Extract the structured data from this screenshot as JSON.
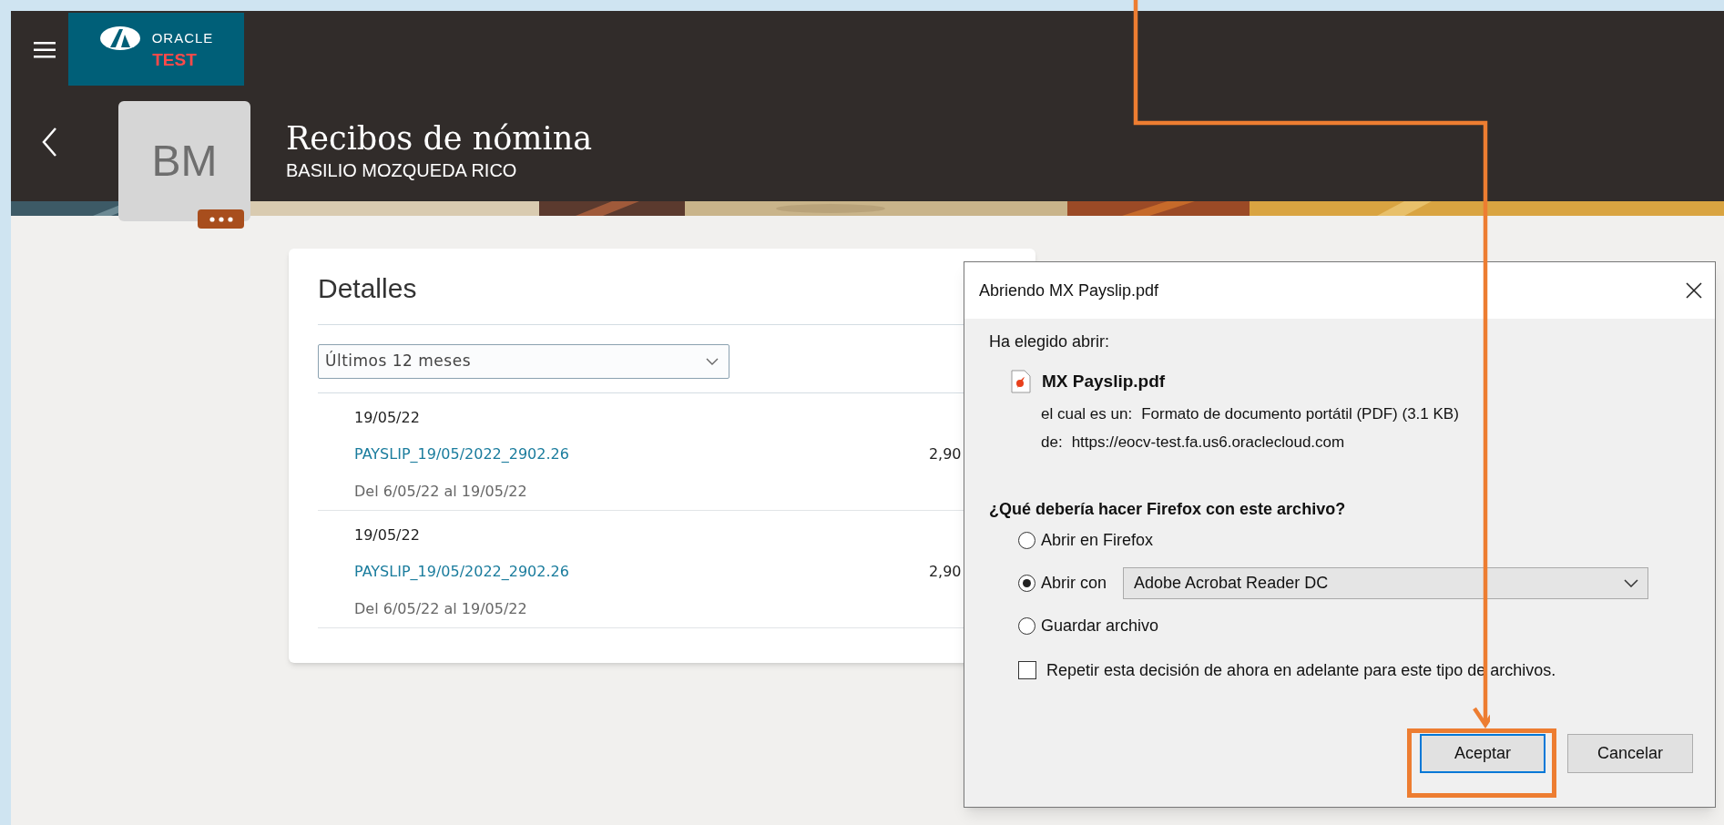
{
  "header": {
    "logo": {
      "wordmark": "ORACLE",
      "badge": "TEST"
    },
    "title": "Recibos de nómina",
    "subtitle": "BASILIO MOZQUEDA RICO",
    "avatar": {
      "initials": "BM"
    }
  },
  "details": {
    "title": "Detalles",
    "period_select": {
      "value": "Últimos 12 meses"
    },
    "rows": [
      {
        "date": "19/05/22",
        "link": "PAYSLIP_19/05/2022_2902.26",
        "amount": "2,90",
        "range": "Del 6/05/22 al 19/05/22"
      },
      {
        "date": "19/05/22",
        "link": "PAYSLIP_19/05/2022_2902.26",
        "amount": "2,90",
        "range": "Del 6/05/22 al 19/05/22"
      }
    ]
  },
  "dialog": {
    "title": "Abriendo MX Payslip.pdf",
    "intro": "Ha elegido abrir:",
    "file_name": "MX Payslip.pdf",
    "info": [
      {
        "label": "el cual es un:",
        "value": "Formato de documento portátil (PDF) (3.1 KB)"
      },
      {
        "label": "de:",
        "value": "https://eocv-test.fa.us6.oraclecloud.com"
      }
    ],
    "question": "¿Qué debería hacer Firefox con este archivo?",
    "options": [
      {
        "label": "Abrir en Firefox",
        "selected": false
      },
      {
        "label": "Abrir con",
        "selected": true
      },
      {
        "label": "Guardar archivo",
        "selected": false
      }
    ],
    "app_select": {
      "value": "Adobe Acrobat Reader DC"
    },
    "remember": {
      "label": "Repetir esta decisión de ahora en adelante para este tipo de archivos.",
      "checked": false
    },
    "buttons": [
      {
        "label": "Aceptar",
        "default": true
      },
      {
        "label": "Cancelar",
        "default": false
      }
    ]
  }
}
